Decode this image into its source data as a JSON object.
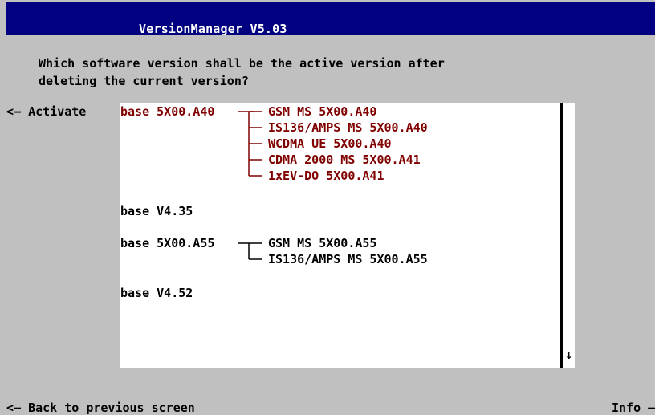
{
  "window": {
    "title": "VersionManager V5.03"
  },
  "prompt": {
    "line1": "Which software version shall be the active version after",
    "line2": "deleting the current version?"
  },
  "softkeys": {
    "activate": "<— Activate",
    "back": "<— Back to previous screen",
    "info": "Info —"
  },
  "versions": [
    {
      "base": "base 5X00.A40",
      "selected": true,
      "modules": [
        "GSM MS 5X00.A40",
        "IS136/AMPS MS 5X00.A40",
        "WCDMA UE 5X00.A40",
        "CDMA 2000 MS 5X00.A41",
        "1xEV-DO 5X00.A41"
      ]
    },
    {
      "base": "base V4.35",
      "selected": false,
      "modules": []
    },
    {
      "base": "base 5X00.A55",
      "selected": false,
      "modules": [
        "GSM MS 5X00.A55",
        "IS136/AMPS MS 5X00.A55"
      ]
    },
    {
      "base": "base V4.52",
      "selected": false,
      "modules": []
    }
  ],
  "scrollbar": {
    "arrow": "↓"
  },
  "colors": {
    "titlebar": "#000080",
    "background": "#c0c0c0",
    "selected_text": "#800000"
  }
}
